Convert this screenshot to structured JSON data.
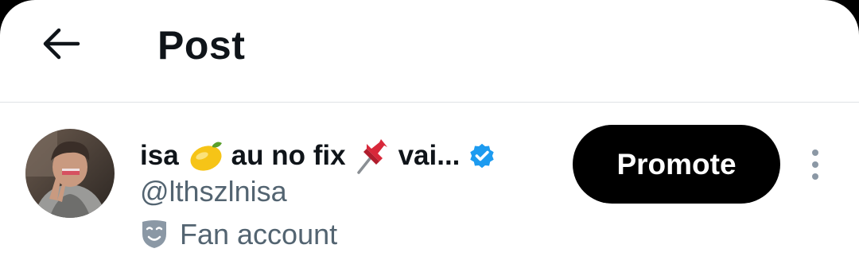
{
  "header": {
    "back_icon": "arrow-left-icon",
    "title": "Post"
  },
  "author": {
    "display_name_part1": "isa",
    "emoji1": "lemon",
    "display_name_part2": "au no fix",
    "emoji2": "pushpin",
    "display_name_part3": "vai...",
    "verified_icon": "verified-badge-icon",
    "handle": "@lthszlnisa",
    "category_icon": "theater-masks-icon",
    "category_label": "Fan account"
  },
  "actions": {
    "promote_label": "Promote",
    "more_icon": "more-vertical-icon"
  },
  "colors": {
    "text_primary": "#0f1419",
    "text_secondary": "#536471",
    "verified": "#1d9bf0",
    "button_bg": "#000000"
  }
}
